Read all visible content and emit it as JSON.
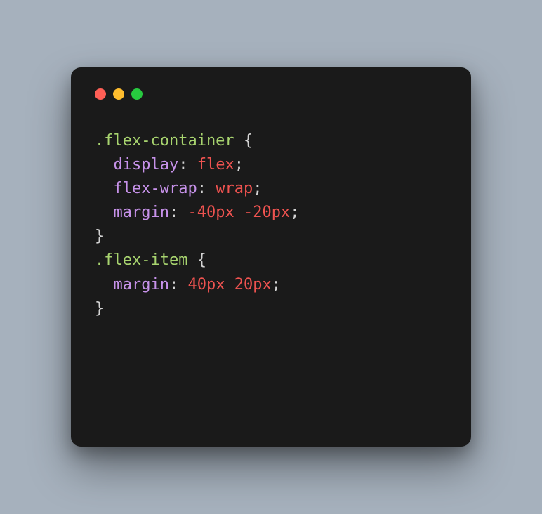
{
  "traffic_lights": {
    "red": "close",
    "yellow": "minimize",
    "green": "maximize"
  },
  "code": {
    "rules": [
      {
        "selector": ".flex-container",
        "declarations": [
          {
            "property": "display",
            "value": "flex",
            "value_type": "keyword"
          },
          {
            "property": "flex-wrap",
            "value": "wrap",
            "value_type": "keyword"
          },
          {
            "property": "margin",
            "value": "-40px -20px",
            "value_type": "number"
          }
        ]
      },
      {
        "selector": ".flex-item",
        "declarations": [
          {
            "property": "margin",
            "value": "40px 20px",
            "value_type": "number"
          }
        ]
      }
    ]
  },
  "syntax": {
    "open_brace": "{",
    "close_brace": "}",
    "colon": ":",
    "semicolon": ";",
    "indent": "  "
  }
}
